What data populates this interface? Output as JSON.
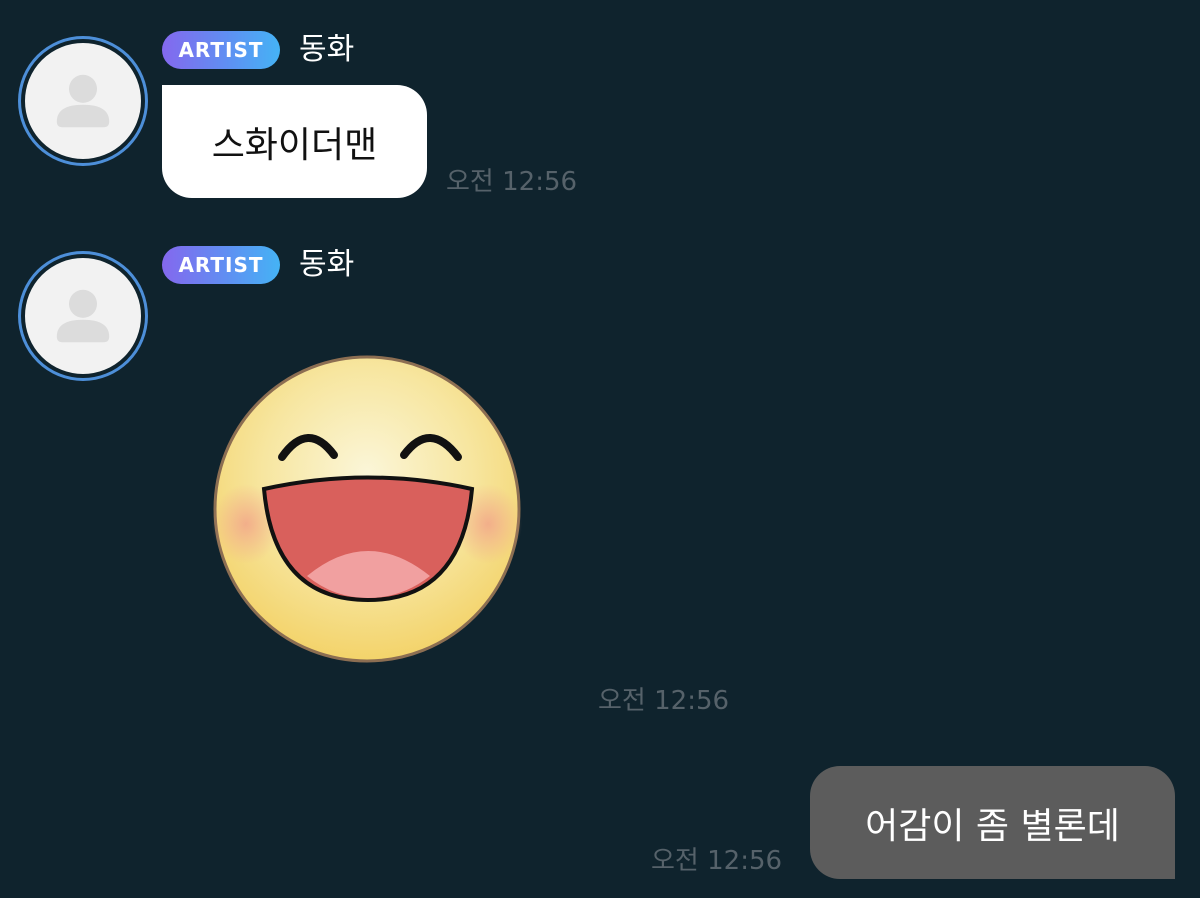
{
  "messages": [
    {
      "sender": {
        "badge": "ARTIST",
        "name": "동화",
        "avatar_icon": "default-user-icon"
      },
      "type": "text",
      "text": "스화이더맨",
      "time": "오전 12:56"
    },
    {
      "sender": {
        "badge": "ARTIST",
        "name": "동화",
        "avatar_icon": "default-user-icon"
      },
      "type": "sticker",
      "sticker_icon": "laughing-face-sticker",
      "time": "오전 12:56"
    },
    {
      "direction": "outgoing",
      "type": "text",
      "text": "어감이 좀 별론데",
      "time": "오전 12:56"
    }
  ],
  "colors": {
    "background": "#0f232d",
    "incoming_bubble": "#ffffff",
    "outgoing_bubble": "#5c5c5c",
    "avatar_ring": "#4d8fd9",
    "badge_gradient": [
      "#8468ee",
      "#45b3f5"
    ],
    "timestamp": "#56626a"
  }
}
